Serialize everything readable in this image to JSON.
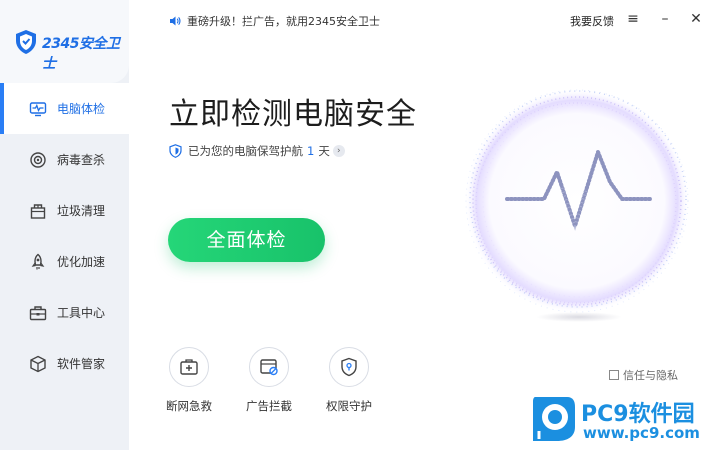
{
  "app": {
    "brand": "2345安全卫士"
  },
  "topbar": {
    "notice": "重磅升级！拦广告，就用2345安全卫士",
    "feedback": "我要反馈",
    "menu_icon": "≡",
    "min_icon": "–",
    "close_icon": "✕"
  },
  "sidebar": {
    "items": [
      {
        "label": "电脑体检",
        "icon": "monitor-pulse-icon",
        "active": true
      },
      {
        "label": "病毒查杀",
        "icon": "target-icon",
        "active": false
      },
      {
        "label": "垃圾清理",
        "icon": "trash-box-icon",
        "active": false
      },
      {
        "label": "优化加速",
        "icon": "rocket-icon",
        "active": false
      },
      {
        "label": "工具中心",
        "icon": "toolbox-icon",
        "active": false
      },
      {
        "label": "软件管家",
        "icon": "cube-icon",
        "active": false
      }
    ]
  },
  "main": {
    "headline": "立即检测电脑安全",
    "protect_prefix": "已为您的电脑保驾护航",
    "protect_days": "1",
    "protect_suffix": "天",
    "protect_arrow": "›",
    "scan_button": "全面体检"
  },
  "tools": [
    {
      "label": "断网急救",
      "icon": "network-rescue-icon"
    },
    {
      "label": "广告拦截",
      "icon": "ad-block-icon"
    },
    {
      "label": "权限守护",
      "icon": "permission-shield-icon"
    }
  ],
  "trust_text": "信任与隐私",
  "watermark": {
    "title": "PC9软件园",
    "url": "www.pc9.com"
  },
  "colors": {
    "accent": "#1f6fe5",
    "green": "#1fcc70",
    "sidebar": "#eef1f6"
  }
}
